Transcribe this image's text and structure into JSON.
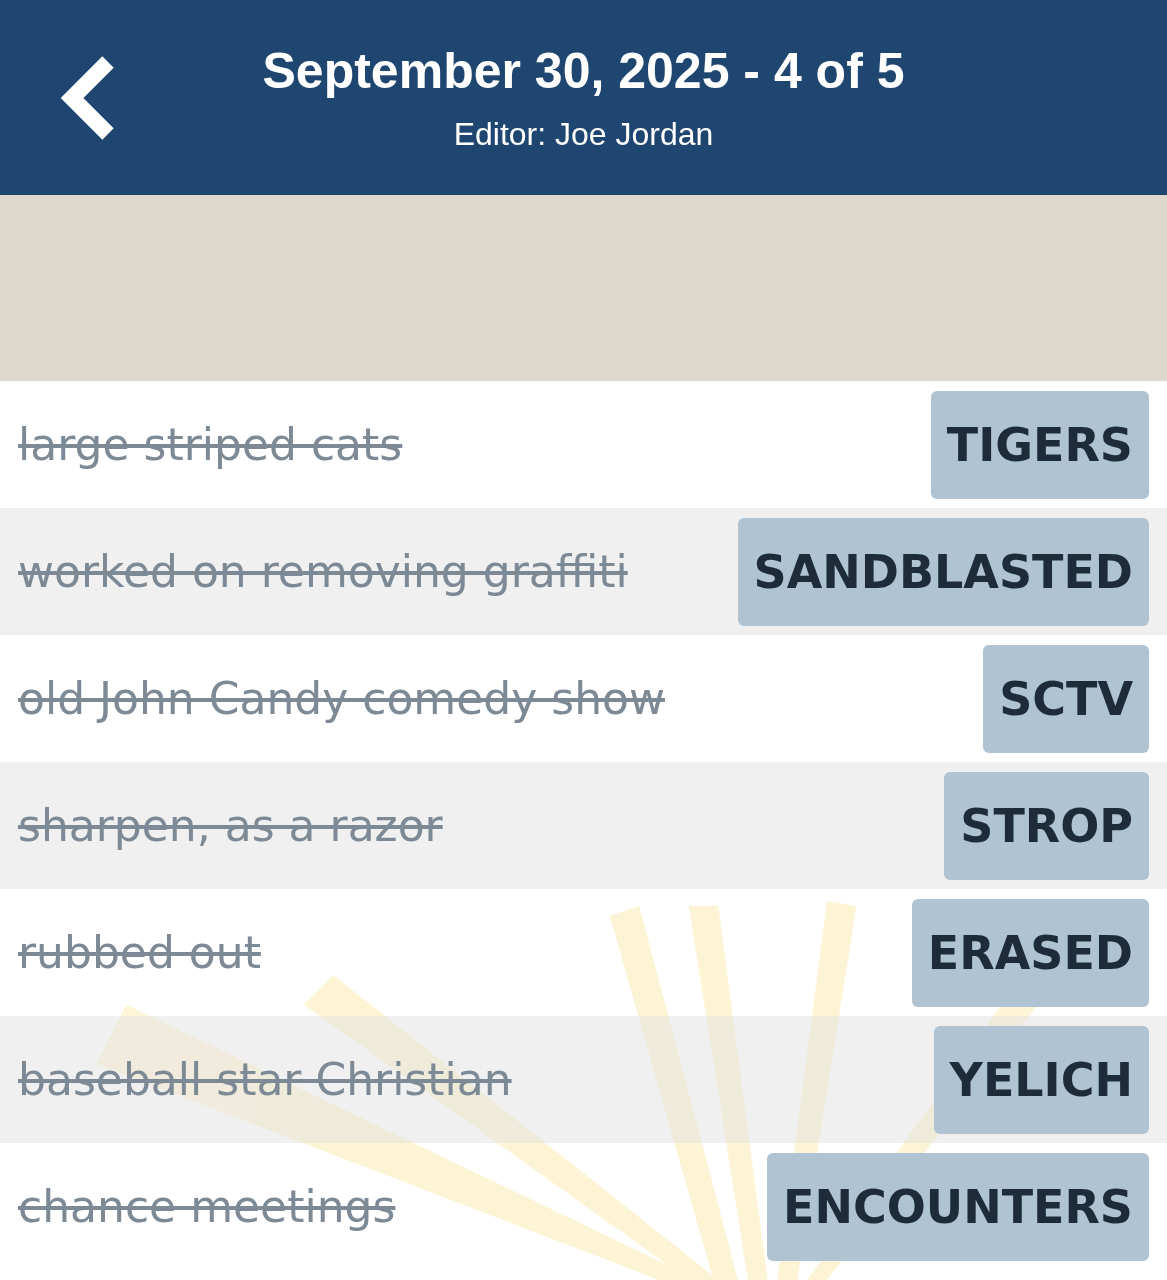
{
  "header": {
    "title": "September 30, 2025 - 4 of 5",
    "subtitle": "Editor: Joe Jordan"
  },
  "clues": [
    {
      "clue": "large striped cats",
      "answer": "TIGERS",
      "solved": true
    },
    {
      "clue": "worked on removing graffiti",
      "answer": "SANDBLASTED",
      "solved": true
    },
    {
      "clue": "old John Candy comedy show",
      "answer": "SCTV",
      "solved": true
    },
    {
      "clue": "sharpen, as a razor",
      "answer": "STROP",
      "solved": true
    },
    {
      "clue": "rubbed out",
      "answer": "ERASED",
      "solved": true
    },
    {
      "clue": "baseball star Christian",
      "answer": "YELICH",
      "solved": true
    },
    {
      "clue": "chance meetings",
      "answer": "ENCOUNTERS",
      "solved": true
    }
  ]
}
